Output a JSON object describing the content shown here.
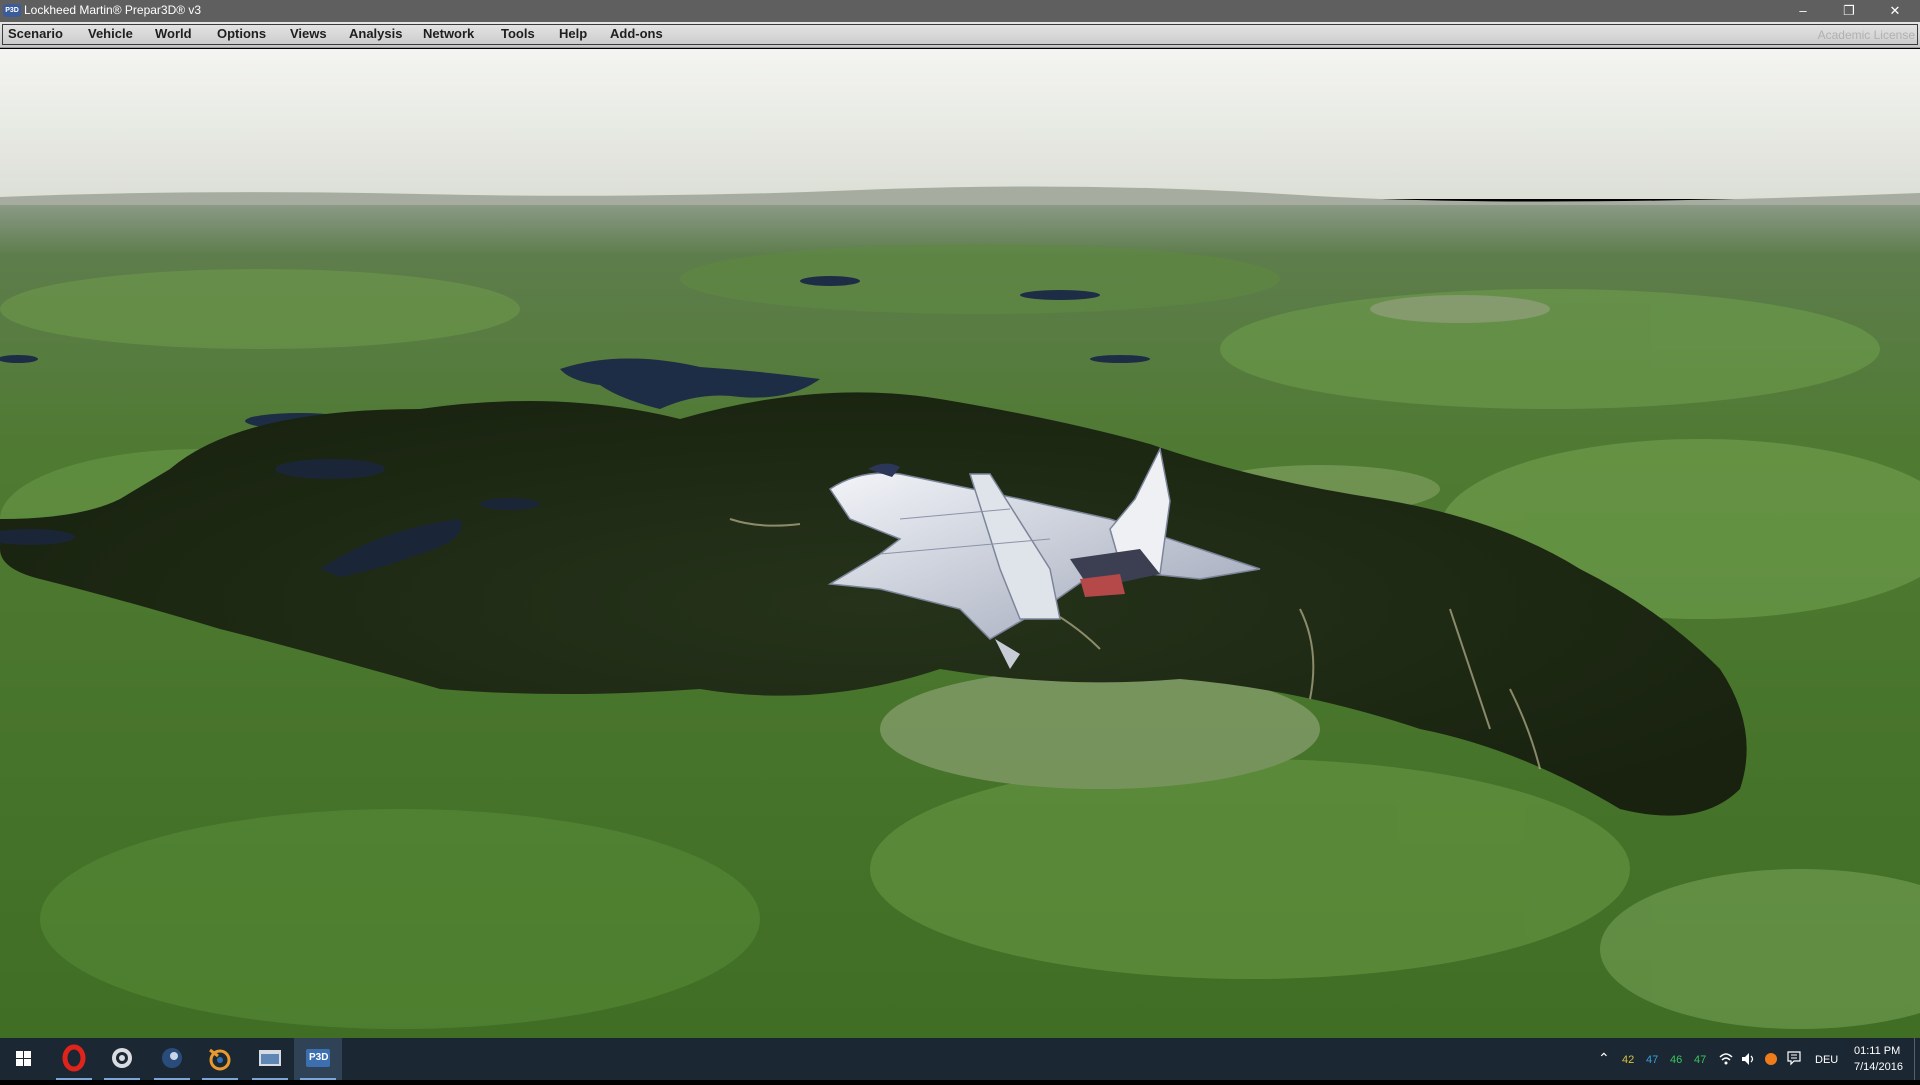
{
  "window": {
    "title": "Lockheed Martin® Prepar3D® v3",
    "app_icon_label": "P3D",
    "controls": {
      "minimize": "–",
      "restore": "❐",
      "close": "✕"
    }
  },
  "menubar": {
    "items": [
      "Scenario",
      "Vehicle",
      "World",
      "Options",
      "Views",
      "Analysis",
      "Network",
      "Tools",
      "Help",
      "Add-ons"
    ],
    "license": "Academic License"
  },
  "scene": {
    "description_icon": "f22-jet-icon",
    "sky_colors": [
      "#f3f4f1",
      "#dfe3d8"
    ],
    "terrain_color": "#4c7a2e",
    "forest_color": "#1d2813",
    "water_color": "#1c2d45"
  },
  "taskbar": {
    "apps": [
      {
        "icon": "windows-start-icon",
        "active": false
      },
      {
        "icon": "opera-icon",
        "active": false,
        "open": true
      },
      {
        "icon": "settings-gear-icon",
        "active": false,
        "open": true
      },
      {
        "icon": "steam-icon",
        "active": false,
        "open": true
      },
      {
        "icon": "blender-icon",
        "active": false,
        "open": true
      },
      {
        "icon": "file-explorer-icon",
        "active": false,
        "open": true
      },
      {
        "icon": "p3d-app-icon",
        "active": true,
        "open": true,
        "label": "P3D"
      }
    ],
    "tray": {
      "cpu_temps": [
        {
          "value": "42",
          "color": "#d6c23a"
        },
        {
          "value": "47",
          "color": "#3aa0d6"
        },
        {
          "value": "46",
          "color": "#3ac45a"
        },
        {
          "value": "47",
          "color": "#3ac45a"
        }
      ],
      "language": "DEU",
      "time": "01:11 PM",
      "date": "7/14/2016"
    }
  }
}
